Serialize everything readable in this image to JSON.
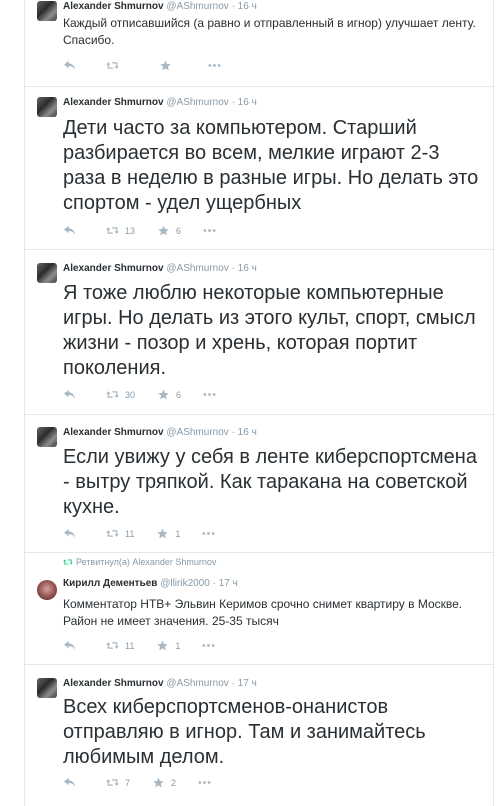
{
  "tweets": [
    {
      "name": "Alexander Shmurnov",
      "handle": "@AShmurnov",
      "time": "· 16 ч",
      "text": "Каждый отписавшийся (а равно и отправленный в игнор) улучшает ленту. Спасибо.",
      "retweets": "",
      "favorites": "",
      "size": "small"
    },
    {
      "name": "Alexander Shmurnov",
      "handle": "@AShmurnov",
      "time": "· 16 ч",
      "text": "Дети часто за компьютером. Старший разбирается во всем, мелкие играют 2-3 раза в неделю в разные игры. Но делать это спортом - удел ущербных",
      "retweets": "13",
      "favorites": "6",
      "size": "big"
    },
    {
      "name": "Alexander Shmurnov",
      "handle": "@AShmurnov",
      "time": "· 16 ч",
      "text": "Я тоже люблю некоторые компьютерные игры. Но делать из этого культ, спорт, смысл жизни - позор и хрень, которая портит поколения.",
      "retweets": "30",
      "favorites": "6",
      "size": "big"
    },
    {
      "name": "Alexander Shmurnov",
      "handle": "@AShmurnov",
      "time": "· 16 ч",
      "text": "Если увижу у себя в ленте киберспортсмена - вытру тряпкой. Как таракана на советской кухне.",
      "retweets": "11",
      "favorites": "1",
      "size": "big"
    },
    {
      "retweet_note": "Ретвитнул(а) Alexander Shmurnov",
      "name": "Кирилл Дементьев",
      "handle": "@llirik2000",
      "time": "· 17 ч",
      "text": "Комментатор НТВ+ Эльвин Керимов срочно снимет квартиру в Москве. Район не имеет значения. 25-35 тысяч",
      "retweets": "11",
      "favorites": "1",
      "size": "small"
    },
    {
      "name": "Alexander Shmurnov",
      "handle": "@AShmurnov",
      "time": "· 17 ч",
      "text": "Всех киберспортсменов-онанистов отправляю в игнор. Там и занимайтесь любимым делом.",
      "retweets": "7",
      "favorites": "2",
      "size": "big"
    }
  ],
  "icons": {
    "reply": "reply-icon",
    "retweet": "retweet-icon",
    "favorite": "star-icon",
    "more": "more-icon"
  }
}
